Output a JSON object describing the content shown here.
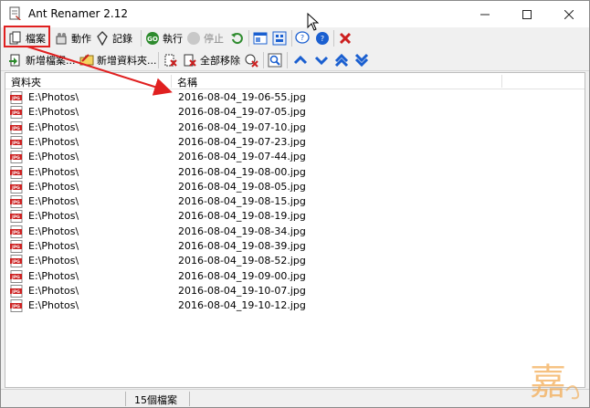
{
  "window": {
    "title": "Ant Renamer 2.12"
  },
  "toolbar1": {
    "files_label": "檔案",
    "actions_label": "動作",
    "log_label": "記錄",
    "go_label": "執行",
    "stop_label": "停止"
  },
  "toolbar2": {
    "add_files_label": "新增檔案...",
    "add_folders_label": "新增資料夾...",
    "remove_all_label": "全部移除"
  },
  "list": {
    "columns": [
      "資料夾",
      "名稱"
    ],
    "rows": [
      {
        "folder": "E:\\Photos\\",
        "name": "2016-08-04_19-06-55.jpg"
      },
      {
        "folder": "E:\\Photos\\",
        "name": "2016-08-04_19-07-05.jpg"
      },
      {
        "folder": "E:\\Photos\\",
        "name": "2016-08-04_19-07-10.jpg"
      },
      {
        "folder": "E:\\Photos\\",
        "name": "2016-08-04_19-07-23.jpg"
      },
      {
        "folder": "E:\\Photos\\",
        "name": "2016-08-04_19-07-44.jpg"
      },
      {
        "folder": "E:\\Photos\\",
        "name": "2016-08-04_19-08-00.jpg"
      },
      {
        "folder": "E:\\Photos\\",
        "name": "2016-08-04_19-08-05.jpg"
      },
      {
        "folder": "E:\\Photos\\",
        "name": "2016-08-04_19-08-15.jpg"
      },
      {
        "folder": "E:\\Photos\\",
        "name": "2016-08-04_19-08-19.jpg"
      },
      {
        "folder": "E:\\Photos\\",
        "name": "2016-08-04_19-08-34.jpg"
      },
      {
        "folder": "E:\\Photos\\",
        "name": "2016-08-04_19-08-39.jpg"
      },
      {
        "folder": "E:\\Photos\\",
        "name": "2016-08-04_19-08-52.jpg"
      },
      {
        "folder": "E:\\Photos\\",
        "name": "2016-08-04_19-09-00.jpg"
      },
      {
        "folder": "E:\\Photos\\",
        "name": "2016-08-04_19-10-07.jpg"
      },
      {
        "folder": "E:\\Photos\\",
        "name": "2016-08-04_19-10-12.jpg"
      }
    ],
    "file_icon_label": "JPG"
  },
  "status": {
    "count": "15個檔案"
  },
  "watermark": {
    "text": "嘉"
  },
  "colors": {
    "highlight": "#e02020",
    "arrow": "#e02020",
    "nav_blue": "#1a5fd0",
    "go_green": "#2e8b2e",
    "remove_red": "#cc1f1f",
    "watermark": "#f2a64a"
  }
}
